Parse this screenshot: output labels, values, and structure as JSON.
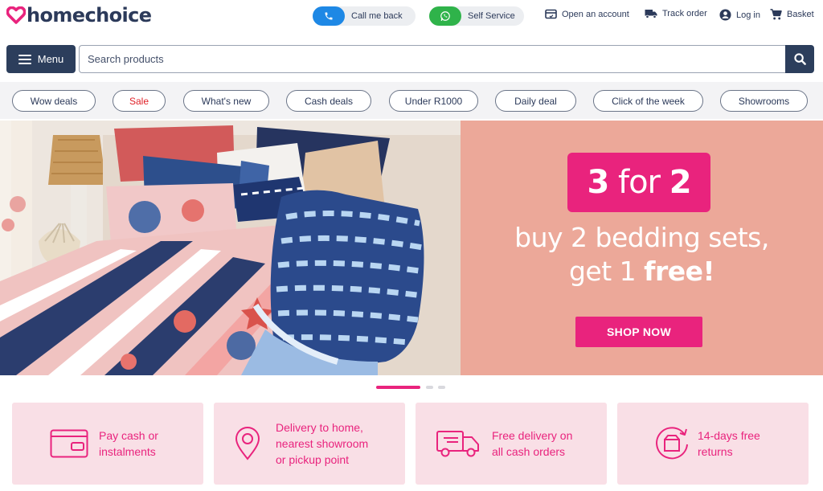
{
  "brand": {
    "name": "homechoice",
    "accent": "#e9237d",
    "navy": "#2c3e5c"
  },
  "top_actions": {
    "call_me_back": "Call me back",
    "self_service": "Self Service"
  },
  "top_links": {
    "open_account": "Open an account",
    "track_order": "Track order",
    "log_in": "Log in",
    "basket": "Basket"
  },
  "search": {
    "menu_label": "Menu",
    "placeholder": "Search products"
  },
  "chips": [
    "Wow deals",
    "Sale",
    "What's new",
    "Cash deals",
    "Under R1000",
    "Daily deal",
    "Click of the week",
    "Showrooms"
  ],
  "hero": {
    "badge_num1": "3",
    "badge_word": "for",
    "badge_num2": "2",
    "line1": "buy 2 bedding sets,",
    "line2_prefix": "get 1 ",
    "line2_bold": "free!",
    "cta": "SHOP NOW",
    "slides": 3,
    "active_slide": 1
  },
  "benefits": [
    {
      "icon": "wallet-card-icon",
      "line1": "Pay cash or",
      "line2": "instalments",
      "line3": ""
    },
    {
      "icon": "location-pin-icon",
      "line1": "Delivery to home,",
      "line2": "nearest showroom",
      "line3": "or pickup point"
    },
    {
      "icon": "delivery-truck-icon",
      "line1": "Free delivery on",
      "line2": "all cash orders",
      "line3": ""
    },
    {
      "icon": "return-box-icon",
      "line1": "14-days free",
      "line2": "returns",
      "line3": ""
    }
  ]
}
